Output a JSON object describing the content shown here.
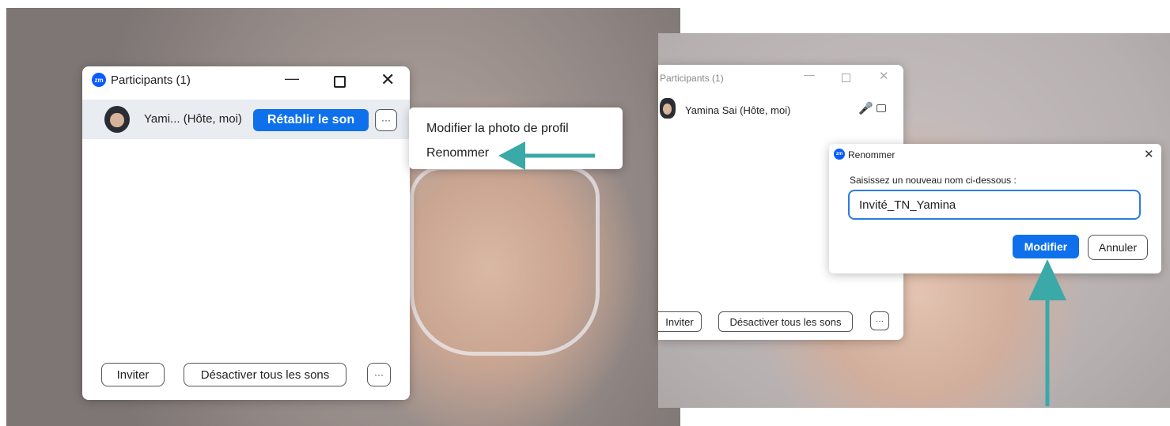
{
  "left": {
    "window_title": "Participants (1)",
    "participant_name": "Yami... (Hôte, moi)",
    "unmute_label": "Rétablir le son",
    "more_label": "···",
    "menu_items": [
      "Modifier la photo de profil",
      "Renommer"
    ],
    "invite_label": "Inviter",
    "mute_all_label": "Désactiver tous les sons",
    "footer_more_label": "···"
  },
  "right": {
    "window_title": "Participants (1)",
    "participant_name": "Yamina Sai (Hôte, moi)",
    "invite_label": "Inviter",
    "mute_all_label": "Désactiver tous les sons",
    "footer_more_label": "···",
    "dialog": {
      "title": "Renommer",
      "prompt": "Saisissez un nouveau nom ci-dessous :",
      "input_value": "Invité_TN_Yamina",
      "confirm_label": "Modifier",
      "cancel_label": "Annuler"
    }
  },
  "logo_text": "zm",
  "colors": {
    "accent": "#0e71eb",
    "arrow": "#3aa9a7"
  }
}
